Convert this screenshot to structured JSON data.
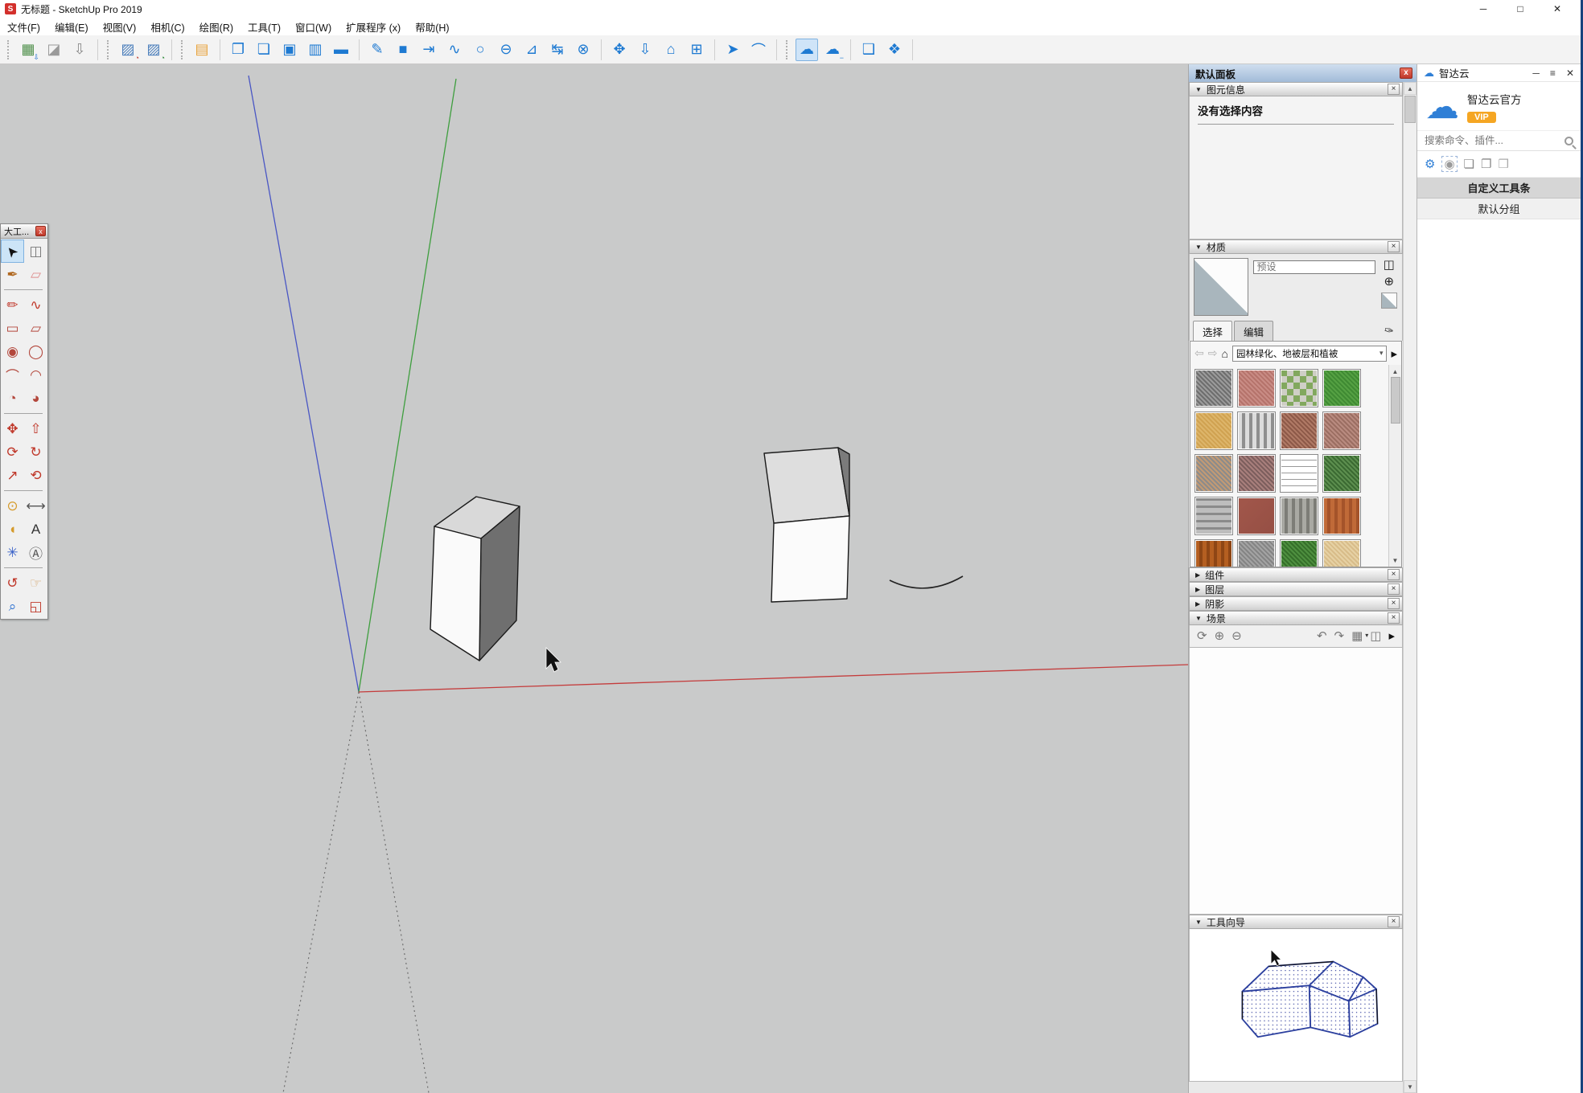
{
  "window": {
    "title": "无标题 - SketchUp Pro 2019",
    "logo_letter": "S",
    "controls": {
      "minimize": "─",
      "maximize": "□",
      "close": "✕"
    }
  },
  "menus": [
    "文件(F)",
    "编辑(E)",
    "视图(V)",
    "相机(C)",
    "绘图(R)",
    "工具(T)",
    "窗口(W)",
    "扩展程序 (x)",
    "帮助(H)"
  ],
  "ui_glyphs": {
    "expanded": "▼",
    "collapsed": "▶",
    "close": "×",
    "chevron_down": "▾",
    "scroll_up": "▲",
    "scroll_down": "▼"
  },
  "toolbar": {
    "groups": [
      {
        "handle": true,
        "icons": [
          {
            "name": "image-export-icon",
            "glyph": "▦",
            "color": "#4e8f4a",
            "badge": "⇩",
            "badge_color": "#1e6fd0"
          },
          {
            "name": "surface-shape-icon",
            "glyph": "◪",
            "color": "#9a9a9a"
          },
          {
            "name": "person-import-icon",
            "glyph": "⇩",
            "color": "#8a8a8a"
          }
        ]
      },
      {
        "handle": true,
        "icons": [
          {
            "name": "hatch-clock-red-icon",
            "glyph": "▨",
            "color": "#4a7ebb",
            "badge": "◔",
            "badge_color": "#c0392b"
          },
          {
            "name": "hatch-clock-green-icon",
            "glyph": "▨",
            "color": "#4a7ebb",
            "badge": "◔",
            "badge_color": "#27862f"
          }
        ]
      },
      {
        "handle": true,
        "icons": [
          {
            "name": "layout-align-icon",
            "glyph": "▤",
            "color": "#e8a33d"
          }
        ]
      },
      {
        "icons": [
          {
            "name": "open-file-icon",
            "glyph": "❐",
            "color": "#1e7ad2"
          },
          {
            "name": "open-folder-icon",
            "glyph": "❏",
            "color": "#1e7ad2"
          },
          {
            "name": "save-icon",
            "glyph": "▣",
            "color": "#1e7ad2"
          },
          {
            "name": "save-all-icon",
            "glyph": "▥",
            "color": "#1e7ad2"
          },
          {
            "name": "import-folder-icon",
            "glyph": "▬",
            "color": "#1e7ad2"
          }
        ]
      },
      {
        "icons": [
          {
            "name": "line-tool-icon",
            "glyph": "✎",
            "color": "#1e7ad2"
          },
          {
            "name": "rectangle-tool-icon",
            "glyph": "■",
            "color": "#1e7ad2"
          },
          {
            "name": "push-in-icon",
            "glyph": "⇥",
            "color": "#1e7ad2"
          },
          {
            "name": "freehand-icon",
            "glyph": "∿",
            "color": "#1e7ad2"
          },
          {
            "name": "circle-tool-icon",
            "glyph": "○",
            "color": "#1e7ad2"
          },
          {
            "name": "circle-minus-icon",
            "glyph": "⊖",
            "color": "#1e7ad2"
          },
          {
            "name": "protractor-tool-icon",
            "glyph": "⊿",
            "color": "#1e7ad2"
          },
          {
            "name": "center-align-icon",
            "glyph": "↹",
            "color": "#1e7ad2"
          },
          {
            "name": "globe-icon",
            "glyph": "⊗",
            "color": "#1e7ad2"
          }
        ]
      },
      {
        "icons": [
          {
            "name": "move-tool-icon",
            "glyph": "✥",
            "color": "#1e7ad2"
          },
          {
            "name": "download-icon",
            "glyph": "⇩",
            "color": "#1e7ad2"
          },
          {
            "name": "house-icon",
            "glyph": "⌂",
            "color": "#1e7ad2"
          },
          {
            "name": "component-grid-icon",
            "glyph": "⊞",
            "color": "#1e7ad2"
          }
        ]
      },
      {
        "icons": [
          {
            "name": "draw-cursor-icon",
            "glyph": "➤",
            "color": "#1e7ad2"
          },
          {
            "name": "arc-curve-icon",
            "glyph": "⌒",
            "color": "#1e7ad2"
          }
        ]
      },
      {
        "handle": true,
        "icons": [
          {
            "name": "cloud-sync-icon",
            "glyph": "☁",
            "color": "#1e7ad2",
            "active": true
          },
          {
            "name": "cloud-remove-icon",
            "glyph": "☁",
            "color": "#1e7ad2",
            "badge": "−",
            "badge_color": "#1e7ad2"
          }
        ]
      },
      {
        "icons": [
          {
            "name": "zoom-extents-icon",
            "glyph": "❑",
            "color": "#1e7ad2"
          },
          {
            "name": "box-3d-icon",
            "glyph": "❖",
            "color": "#1e7ad2"
          }
        ]
      }
    ]
  },
  "palette": {
    "title": "大工...",
    "close_glyph": "x",
    "rows": [
      [
        {
          "name": "select-tool-icon",
          "glyph": "➤",
          "color": "#111111",
          "active": true,
          "rotate": -130
        },
        {
          "name": "make-component-icon",
          "glyph": "◫",
          "color": "#777777"
        }
      ],
      [
        {
          "name": "paint-bucket-icon",
          "glyph": "✒",
          "color": "#b06820"
        },
        {
          "name": "eraser-icon",
          "glyph": "▱",
          "color": "#de8f8f"
        }
      ],
      "sep",
      [
        {
          "name": "line-pencil-icon",
          "glyph": "✏",
          "color": "#c0392b"
        },
        {
          "name": "freehand-tool-icon",
          "glyph": "∿",
          "color": "#c0392b"
        }
      ],
      [
        {
          "name": "rectangle-icon",
          "glyph": "▭",
          "color": "#b3473c"
        },
        {
          "name": "rotated-rectangle-icon",
          "glyph": "▱",
          "color": "#b3473c"
        }
      ],
      [
        {
          "name": "circle-icon",
          "glyph": "◉",
          "color": "#b3473c"
        },
        {
          "name": "polygon-icon",
          "glyph": "◯",
          "color": "#b3473c"
        }
      ],
      [
        {
          "name": "arc-icon",
          "glyph": "⌒",
          "color": "#b3473c"
        },
        {
          "name": "two-point-arc-icon",
          "glyph": "◠",
          "color": "#b3473c"
        }
      ],
      [
        {
          "name": "pie-arc-icon",
          "glyph": "◔",
          "color": "#b3473c"
        },
        {
          "name": "three-point-arc-icon",
          "glyph": "◕",
          "color": "#b3473c"
        }
      ],
      "sep",
      [
        {
          "name": "move-icon",
          "glyph": "✥",
          "color": "#c0392b"
        },
        {
          "name": "push-pull-icon",
          "glyph": "⇧",
          "color": "#c0392b"
        }
      ],
      [
        {
          "name": "rotate-icon",
          "glyph": "⟳",
          "color": "#c0392b"
        },
        {
          "name": "follow-me-icon",
          "glyph": "↻",
          "color": "#c0392b"
        }
      ],
      [
        {
          "name": "scale-icon",
          "glyph": "↗",
          "color": "#c0392b"
        },
        {
          "name": "offset-icon",
          "glyph": "⟲",
          "color": "#c0392b"
        }
      ],
      "sep",
      [
        {
          "name": "tape-measure-icon",
          "glyph": "⊙",
          "color": "#d59b2c"
        },
        {
          "name": "dimension-icon",
          "glyph": "⟷",
          "color": "#555555"
        }
      ],
      [
        {
          "name": "protractor-icon",
          "glyph": "◖",
          "color": "#d59b2c"
        },
        {
          "name": "text-tool-icon",
          "glyph": "A",
          "color": "#333333"
        }
      ],
      [
        {
          "name": "axes-icon",
          "glyph": "✳",
          "color": "#3a62c8"
        },
        {
          "name": "3d-text-icon",
          "glyph": "Ⓐ",
          "color": "#555555"
        }
      ],
      "sep",
      [
        {
          "name": "orbit-icon",
          "glyph": "↺",
          "color": "#c0392b"
        },
        {
          "name": "pan-icon",
          "glyph": "☞",
          "color": "#d5a870"
        }
      ],
      [
        {
          "name": "zoom-icon",
          "glyph": "⌕",
          "color": "#2a6fd0"
        },
        {
          "name": "zoom-window-icon",
          "glyph": "◱",
          "color": "#c0392b"
        }
      ]
    ]
  },
  "default_panel": {
    "title": "默认面板",
    "close_glyph": "x",
    "entity_info": {
      "label": "图元信息",
      "empty_text": "没有选择内容"
    },
    "materials": {
      "label": "材质",
      "preset_placeholder": "预设",
      "pane_icon_glyph": "◫",
      "create_icon_glyph": "⊕",
      "eyedropper_glyph": "✑",
      "tabs": [
        "选择",
        "编辑"
      ],
      "nav": {
        "back": "⇦",
        "forward": "⇨",
        "home": "⌂",
        "detail": "▸"
      },
      "category": "园林绿化、地被层和植被",
      "swatches": [
        {
          "name": "material-gray-gravel",
          "c1": "#9b9b9b",
          "c2": "#6e6e6e",
          "pattern": "noise"
        },
        {
          "name": "material-red-pavement",
          "c1": "#c98c85",
          "c2": "#b5736b",
          "pattern": "noise"
        },
        {
          "name": "material-grass-pavers",
          "c1": "#cfcfc6",
          "c2": "#82a85e",
          "pattern": "checker"
        },
        {
          "name": "material-grass",
          "c1": "#55a143",
          "c2": "#3f8a33",
          "pattern": "noise"
        },
        {
          "name": "material-sand",
          "c1": "#ddb56a",
          "c2": "#d0a251",
          "pattern": "noise"
        },
        {
          "name": "material-gray-fence",
          "c1": "#dcdcdc",
          "c2": "#8f8f8f",
          "pattern": "stripesV"
        },
        {
          "name": "material-brown-leaves",
          "c1": "#b07a66",
          "c2": "#8d5948",
          "pattern": "noise"
        },
        {
          "name": "material-red-gravel",
          "c1": "#b98b80",
          "c2": "#9b6e62",
          "pattern": "noise"
        },
        {
          "name": "material-mixed-gravel",
          "c1": "#c29a74",
          "c2": "#8b8b8b",
          "pattern": "noise"
        },
        {
          "name": "material-granite",
          "c1": "#a87f7c",
          "c2": "#7c5e5d",
          "pattern": "noise"
        },
        {
          "name": "material-barbed-wire",
          "c1": "#ffffff",
          "c2": "#9a9a9a",
          "pattern": "thinH"
        },
        {
          "name": "material-ivy",
          "c1": "#5d8f4f",
          "c2": "#3b6a32",
          "pattern": "noise"
        },
        {
          "name": "material-stone-rounds",
          "c1": "#bdbdbd",
          "c2": "#8a8a8a",
          "pattern": "stripesH"
        },
        {
          "name": "material-red-brick",
          "c1": "#a2574b",
          "c2": "#954f44",
          "pattern": "solid"
        },
        {
          "name": "material-gray-planks",
          "c1": "#a9a9a3",
          "c2": "#7d7d77",
          "pattern": "stripesV"
        },
        {
          "name": "material-orange-fence",
          "c1": "#c06a38",
          "c2": "#a4532a",
          "pattern": "stripesV"
        },
        {
          "name": "material-orange-planks",
          "c1": "#b45f21",
          "c2": "#8e4615",
          "pattern": "stripesV"
        },
        {
          "name": "material-fine-gravel",
          "c1": "#a3a3a3",
          "c2": "#848484",
          "pattern": "noise"
        },
        {
          "name": "material-shrub",
          "c1": "#4f9040",
          "c2": "#356f2a",
          "pattern": "noise"
        },
        {
          "name": "material-cork",
          "c1": "#e6d1a4",
          "c2": "#d8bc89",
          "pattern": "noise"
        }
      ]
    },
    "collapsed_sections": [
      "组件",
      "图层",
      "阴影"
    ],
    "scenes": {
      "label": "场景",
      "icons_left": [
        {
          "name": "refresh-scene-icon",
          "glyph": "⟳"
        },
        {
          "name": "add-scene-icon",
          "glyph": "⊕"
        },
        {
          "name": "remove-scene-icon",
          "glyph": "⊖"
        }
      ],
      "icons_right": [
        {
          "name": "scene-up-icon",
          "glyph": "↶"
        },
        {
          "name": "scene-down-icon",
          "glyph": "↷"
        },
        {
          "name": "scene-view-options-icon",
          "glyph": "▦",
          "badge": "▾"
        },
        {
          "name": "scene-details-pane-icon",
          "glyph": "◫"
        },
        {
          "name": "scene-detail-arrow-icon",
          "glyph": "▸",
          "color": "#111111"
        }
      ]
    },
    "instructor": {
      "label": "工具向导"
    }
  },
  "cloud_panel": {
    "title": "智达云",
    "logo_glyph": "☁",
    "controls": {
      "minimize": "─",
      "menu": "≡",
      "close": "✕"
    },
    "account_name": "智达云官方",
    "vip_badge": "VIP",
    "search_placeholder": "搜索命令、插件...",
    "icons": [
      {
        "name": "settings-gear-icon",
        "glyph": "⚙",
        "color": "#2f7fd6"
      },
      {
        "name": "selection-eye-icon",
        "glyph": "◉",
        "color": "#9a9a9a",
        "boxed": true
      },
      {
        "name": "stamp-tool-icon",
        "glyph": "❏",
        "color": "#8a8a8a"
      },
      {
        "name": "copy-tool-icon",
        "glyph": "❐",
        "color": "#8a8a8a"
      },
      {
        "name": "paste-tool-icon",
        "glyph": "❒",
        "color": "#ababab"
      }
    ],
    "buttons": {
      "custom_toolbar": "自定义工具条",
      "default_group": "默认分组"
    }
  }
}
